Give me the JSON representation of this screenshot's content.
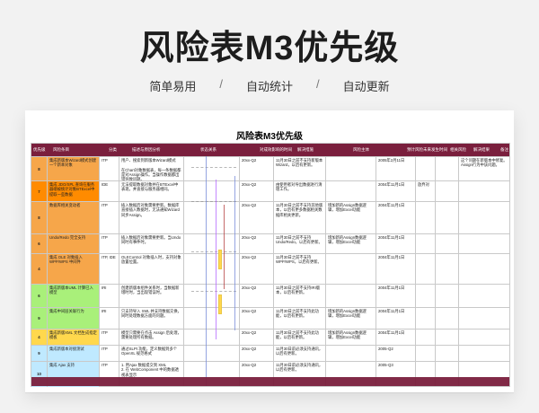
{
  "header": {
    "title": "风险表M3优先级",
    "taglines": [
      "简单易用",
      "/",
      "自动统计",
      "/",
      "自动更新"
    ]
  },
  "sheet": {
    "title": "风险表M3优先级",
    "columns": [
      "优先级",
      "风险条目",
      "分类",
      "描述与原因分析",
      "状态关系",
      "对成效影响的时间",
      "解决措施",
      "风险主体",
      "预计风险未来发生时间",
      "相关风险",
      "解决结果",
      "备注"
    ],
    "rows": [
      {
        "no": "8",
        "item": "集成新版本Wizard模式创建一个新本对象",
        "type": "ITP",
        "desc": "用户、搜索到新版本Wizard模式\n\n在Chart对象数据表，每一条数据都是对Assign操作。当操作数据都出错导致问题。\n事数无法通过本对象的数据相关一些问题。",
        "time": "20xx-Q2",
        "measure": "11月30日之前不支持新版本Wizard，以后有更新。",
        "owner": "",
        "eta": "2005年2月11日",
        "related": "",
        "result": "",
        "note": "这个问题在新版本中修复。Assign行为中该问题。"
      },
      {
        "no": "7",
        "item": "集成 JDO/SPL 查询在服务器端被统计对象BTExcel中提取一些数据",
        "type": "IDE",
        "desc": "无法提取数据对象并在BTExcel中表现，并直接与服务器相同。",
        "time": "20xx-Q2",
        "measure": "由使用者对导出数据进行清理工作。",
        "owner": "",
        "eta": "2004年11月1日",
        "related": "放弃对",
        "result": "",
        "note": ""
      },
      {
        "no": "8",
        "item": "数据库相关变动者",
        "type": "ITP",
        "desc": "插入数据后对象需要更新。数据库直接插入数据时，无法通知Wizard同步Assign。",
        "time": "20xx-Q2",
        "measure": "11月30日之前不支持其他版本，以后有更多数据相关数据库相关更新。",
        "owner": "增加新的Assign数据逻辑，增加Excel功能",
        "eta": "2004年11月1日",
        "related": "",
        "result": "",
        "note": ""
      },
      {
        "no": "6",
        "item": "Undo/Redo 完全支持",
        "type": "ITP",
        "desc": "插入数据后对象需要更新。当Undo同时有事件时。",
        "time": "20xx-Q2",
        "measure": "11月30日之前不支持Undo/Redo，以后有更新。",
        "owner": "增加新的Assign数据逻辑，增加Excel功能",
        "eta": "2004年11月1日",
        "related": "",
        "result": "",
        "note": ""
      },
      {
        "no": "4",
        "item": "集成 OLE 对象插入 WPP/WPS 中间件",
        "type": "ITP, IDE",
        "desc": "OLEControl 对象插入时，支持对象放置位置。",
        "time": "20xx-Q2",
        "measure": "11月30日之前不支持 WPP/WPS，以后有更新。",
        "owner": "",
        "eta": "2004年11月1日",
        "related": "",
        "result": "",
        "note": ""
      },
      {
        "no": "6",
        "item": "集成新版本UML 计算已入模型",
        "type": "IRI",
        "desc": "创建新版本组件关系时，当数据新增时时，当出现错误时。",
        "time": "20xx-Q2",
        "measure": "11月30日之前不支持IRI版本，以后有更新。",
        "owner": "",
        "eta": "2004年11月1日",
        "related": "",
        "result": "",
        "note": ""
      },
      {
        "no": "9",
        "item": "集成中间层关联行为",
        "type": "IRI",
        "desc": "只支持导入 XML 并支持数据交换，同时处理数据方面的问题。",
        "time": "20xx-Q2",
        "measure": "11月30日之前不支持此功能，以后有更新。",
        "owner": "增加新的Assign数据逻辑，增加Excel功能",
        "eta": "2004年11月1日",
        "related": "",
        "result": "",
        "note": ""
      },
      {
        "no": "4",
        "item": "集成新版XML 文档生成指定模板",
        "type": "ITP",
        "desc": "模型只需要在点击 Assign 后处理，需要处理所有数据。",
        "time": "20xx-Q2",
        "measure": "11月30日之前不支持此功能，以后有更新。",
        "owner": "增加新的Assign数据逻辑，增加Excel功能",
        "eta": "2004年11月1日",
        "related": "",
        "result": "",
        "note": ""
      },
      {
        "no": "9",
        "item": "集成新版本对接测试",
        "type": "ITP",
        "desc": "通过SLPt 功能，定义数据到多个 OpenXL 规范格式",
        "time": "20xx-Q2",
        "measure": "11月30日前必须支持通讯，以后有更新。",
        "owner": "",
        "eta": "2005-Q2",
        "related": "",
        "result": "",
        "note": ""
      },
      {
        "no": "10",
        "item": "集成 Ajax 支持",
        "type": "ITP",
        "desc": "1. 用Ajax 数据提交到 XML\n2. 在 WebComponent 中的数据透视表显示",
        "time": "20xx-Q2",
        "measure": "11月30日前必须支持通讯，以后有更新。",
        "owner": "",
        "eta": "2005-Q3",
        "related": "",
        "result": "",
        "note": ""
      }
    ]
  }
}
